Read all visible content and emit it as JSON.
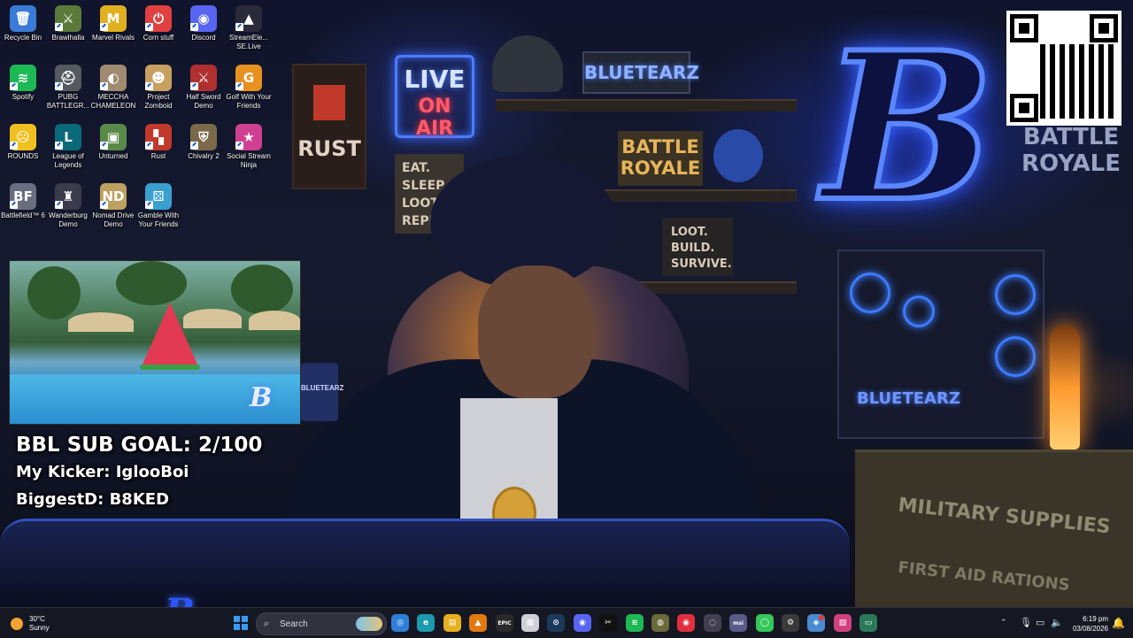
{
  "desktop": {
    "icons": [
      {
        "label": "Recycle Bin",
        "glyph": "🗑",
        "color": "#3a7bd5",
        "icon": "recycle-bin-icon"
      },
      {
        "label": "Brawlhalla",
        "glyph": "⚔",
        "color": "#5a7a3a",
        "icon": "brawlhalla-icon"
      },
      {
        "label": "Marvel Rivals",
        "glyph": "M",
        "color": "#e0b020",
        "icon": "marvel-rivals-icon"
      },
      {
        "label": "Corn stuff",
        "glyph": "⏻",
        "color": "#e04040",
        "icon": "corn-stuff-icon"
      },
      {
        "label": "Discord",
        "glyph": "◉",
        "color": "#5865f2",
        "icon": "discord-icon"
      },
      {
        "label": "StreamEle... SE.Live",
        "glyph": "▲",
        "color": "#2a2a3a",
        "icon": "streamelements-icon"
      },
      {
        "label": "Spotify",
        "glyph": "≋",
        "color": "#1db954",
        "icon": "spotify-icon"
      },
      {
        "label": "PUBG BATTLEGR...",
        "glyph": "⛑",
        "color": "#555a60",
        "icon": "pubg-icon"
      },
      {
        "label": "MECCHA CHAMELEON",
        "glyph": "◐",
        "color": "#a08a70",
        "icon": "meccha-chameleon-icon"
      },
      {
        "label": "Project Zomboid",
        "glyph": "☻",
        "color": "#c8a060",
        "icon": "project-zomboid-icon"
      },
      {
        "label": "Half Sword Demo",
        "glyph": "⚔",
        "color": "#b03030",
        "icon": "half-sword-icon"
      },
      {
        "label": "Golf With Your Friends",
        "glyph": "G",
        "color": "#e89020",
        "icon": "golf-with-friends-icon"
      },
      {
        "label": "ROUNDS",
        "glyph": "☹",
        "color": "#f0c020",
        "icon": "rounds-icon"
      },
      {
        "label": "League of Legends",
        "glyph": "L",
        "color": "#0a6a7a",
        "icon": "league-of-legends-icon"
      },
      {
        "label": "Unturned",
        "glyph": "▣",
        "color": "#5a8a4a",
        "icon": "unturned-icon"
      },
      {
        "label": "Rust",
        "glyph": "▚",
        "color": "#c0392b",
        "icon": "rust-icon"
      },
      {
        "label": "Chivalry 2",
        "glyph": "⛨",
        "color": "#7a6a4a",
        "icon": "chivalry-2-icon"
      },
      {
        "label": "Social Stream Ninja",
        "glyph": "★",
        "color": "#d04090",
        "icon": "social-stream-ninja-icon"
      },
      {
        "label": "Battlefield™ 6",
        "glyph": "BF",
        "color": "#6a6f80",
        "icon": "battlefield-6-icon"
      },
      {
        "label": "Wanderburg Demo",
        "glyph": "♜",
        "color": "#3a3a4a",
        "icon": "wanderburg-icon"
      },
      {
        "label": "Nomad Drive Demo",
        "glyph": "ND",
        "color": "#c0a060",
        "icon": "nomad-drive-icon"
      },
      {
        "label": "Gamble With Your Friends",
        "glyph": "⚄",
        "color": "#3aa0d0",
        "icon": "gamble-with-friends-icon"
      }
    ]
  },
  "wallpaper": {
    "rust_sign": "RUST",
    "live_line1": "LIVE",
    "live_line2": "ON AIR",
    "eat_sign": [
      "EAT.",
      "SLEEP.",
      "LOOT.",
      "REPEAT."
    ],
    "bluetearz_sign": "BLUETEARZ",
    "battle_royale_1": "BATTLE ROYALE",
    "loot_sign": [
      "LOOT.",
      "BUILD.",
      "SURVIVE."
    ],
    "big_letter": "B",
    "battle_royale_2": "BATTLE ROYALE",
    "pc_label": "BLUETEARZ",
    "crate_line1": "MILITARY SUPPLIES",
    "crate_line2": "FIRST AID RATIONS",
    "desk_letter": "B",
    "mug_label": "BLUETEARZ"
  },
  "overlay": {
    "sub_goal": "BBL SUB GOAL: 2/100",
    "kicker": "My Kicker: IglooBoi",
    "biggest": "BiggestD: B8KED"
  },
  "camera": {
    "watermark": "B"
  },
  "taskbar": {
    "weather_temp": "30°C",
    "weather_desc": "Sunny",
    "search_placeholder": "Search",
    "apps": [
      {
        "icon": "chrome-icon",
        "glyph": "◎",
        "color": "#2f7fd8"
      },
      {
        "icon": "edge-icon",
        "glyph": "e",
        "color": "#1c9ab0"
      },
      {
        "icon": "file-explorer-icon",
        "glyph": "▤",
        "color": "#e8b020"
      },
      {
        "icon": "vlc-icon",
        "glyph": "▲",
        "color": "#e07a10"
      },
      {
        "icon": "epic-games-icon",
        "glyph": "EPIC",
        "color": "#2a2a2a"
      },
      {
        "icon": "notepad-icon",
        "glyph": "▦",
        "color": "#d0d0d8"
      },
      {
        "icon": "steam-icon",
        "glyph": "⊙",
        "color": "#1b3a5a"
      },
      {
        "icon": "discord-icon",
        "glyph": "◉",
        "color": "#5865f2"
      },
      {
        "icon": "capcut-icon",
        "glyph": "✂",
        "color": "#111111"
      },
      {
        "icon": "spotify-icon",
        "glyph": "≋",
        "color": "#1db954"
      },
      {
        "icon": "globe-icon",
        "glyph": "◍",
        "color": "#6a6a3a"
      },
      {
        "icon": "streamlabs-icon",
        "glyph": "◉",
        "color": "#e03040"
      },
      {
        "icon": "obs-icon",
        "glyph": "◌",
        "color": "#404050"
      },
      {
        "icon": "msi-icon",
        "glyph": "msi",
        "color": "#5a5a8a"
      },
      {
        "icon": "line-icon",
        "glyph": "◯",
        "color": "#34c759"
      },
      {
        "icon": "steelseries-icon",
        "glyph": "⚙",
        "color": "#3a3a3a"
      },
      {
        "icon": "snipping-icon",
        "glyph": "◈",
        "color": "#4a8ad0"
      },
      {
        "icon": "game-icon",
        "glyph": "▧",
        "color": "#d04080"
      },
      {
        "icon": "monitor-icon",
        "glyph": "▭",
        "color": "#2a7a5a"
      }
    ],
    "time": "6:19 pm",
    "date": "03/08/2026"
  }
}
